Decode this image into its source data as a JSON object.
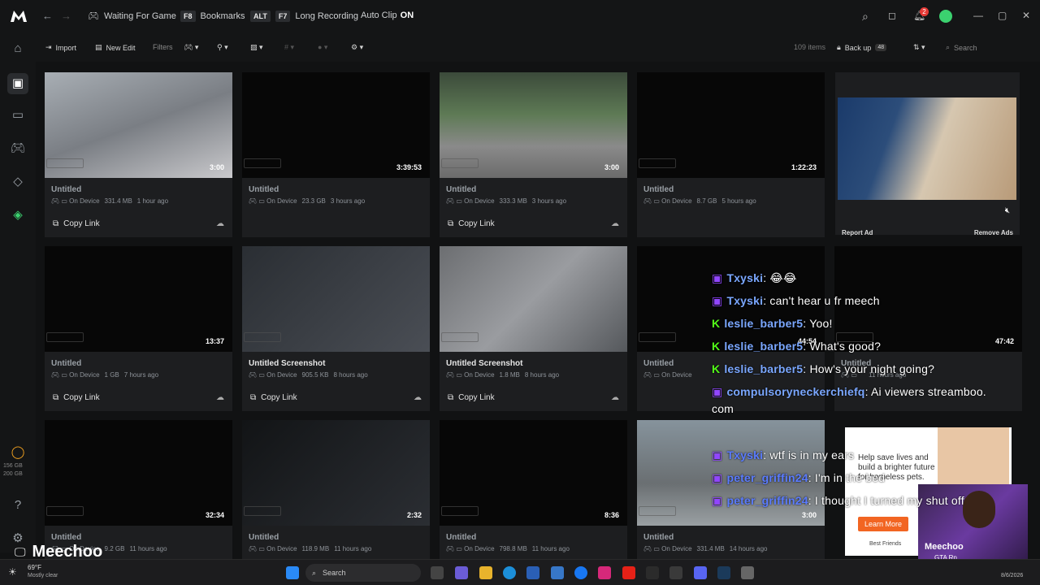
{
  "titlebar": {
    "status": "Waiting For Game",
    "bookmarks_key": "F8",
    "bookmarks_label": "Bookmarks",
    "alt_key": "ALT",
    "long_key": "F7",
    "long_label": "Long Recording",
    "autoclip_label": "Auto Clip",
    "autoclip_state": "ON",
    "notif_count": "2"
  },
  "toolbar": {
    "import": "Import",
    "new_edit": "New Edit",
    "filters": "Filters",
    "count": "109 items",
    "backup": "Back up",
    "backup_count": "48",
    "search_placeholder": "Search"
  },
  "storage": {
    "used": "156 GB",
    "total": "200 GB"
  },
  "cards": [
    {
      "title": "Untitled",
      "where": "On Device",
      "size": "331.4 MB",
      "age": "1 hour ago",
      "dur": "3:00",
      "copy": "Copy Link"
    },
    {
      "title": "Untitled",
      "where": "On Device",
      "size": "23.3 GB",
      "age": "3 hours ago",
      "dur": "3:39:53",
      "copy": ""
    },
    {
      "title": "Untitled",
      "where": "On Device",
      "size": "333.3 MB",
      "age": "3 hours ago",
      "dur": "3:00",
      "copy": "Copy Link"
    },
    {
      "title": "Untitled",
      "where": "On Device",
      "size": "8.7 GB",
      "age": "5 hours ago",
      "dur": "1:22:23",
      "copy": ""
    },
    {
      "title": "Untitled",
      "where": "On Device",
      "size": "1 GB",
      "age": "7 hours ago",
      "dur": "13:37",
      "copy": "Copy Link"
    },
    {
      "title": "Untitled Screenshot",
      "where": "On Device",
      "size": "905.5 KB",
      "age": "8 hours ago",
      "dur": "",
      "copy": "Copy Link"
    },
    {
      "title": "Untitled Screenshot",
      "where": "On Device",
      "size": "1.8 MB",
      "age": "8 hours ago",
      "dur": "",
      "copy": "Copy Link"
    },
    {
      "title": "Untitled",
      "where": "On Device",
      "size": "",
      "age": "",
      "dur": "44:54",
      "copy": ""
    },
    {
      "title": "Untitled",
      "where": "",
      "size": "",
      "age": "11 hours ago",
      "dur": "47:42",
      "copy": ""
    },
    {
      "title": "Untitled",
      "where": "On Device",
      "size": "9.2 GB",
      "age": "11 hours ago",
      "dur": "32:34",
      "copy": ""
    },
    {
      "title": "Untitled",
      "where": "On Device",
      "size": "118.9 MB",
      "age": "11 hours ago",
      "dur": "2:32",
      "copy": ""
    },
    {
      "title": "Untitled",
      "where": "On Device",
      "size": "798.8 MB",
      "age": "11 hours ago",
      "dur": "8:36",
      "copy": ""
    },
    {
      "title": "Untitled",
      "where": "On Device",
      "size": "331.4 MB",
      "age": "14 hours ago",
      "dur": "3:00",
      "copy": ""
    }
  ],
  "ad": {
    "report": "Report Ad",
    "remove": "Remove Ads",
    "ad2_text": "Help save lives and build a brighter future for homeless pets.",
    "ad2_button": "Learn More",
    "ad2_brand": "Best Friends"
  },
  "chat": [
    {
      "user": "Txyski",
      "msg": "😂😂",
      "color": "#7aa7ff",
      "badge": "twitch"
    },
    {
      "user": "Txyski",
      "msg": "can't hear u fr meech",
      "color": "#7aa7ff",
      "badge": "twitch"
    },
    {
      "user": "leslie_barber5",
      "msg": "Yoo!",
      "color": "#7aa7ff",
      "badge": "kick"
    },
    {
      "user": "leslie_barber5",
      "msg": "What's good?",
      "color": "#7aa7ff",
      "badge": "kick"
    },
    {
      "user": "leslie_barber5",
      "msg": "How's your night going?",
      "color": "#7aa7ff",
      "badge": "kick"
    },
    {
      "user": "compulsoryneckerchiefq",
      "msg": "Ai viewers streamboo.",
      "color": "#7aa7ff",
      "badge": "twitch"
    },
    {
      "user": "",
      "msg": "com",
      "color": "#fff",
      "badge": ""
    },
    {
      "user": "Txyski",
      "msg": "wtf is in my ears",
      "color": "#5b7cff",
      "badge": "twitch"
    },
    {
      "user": "peter_griffin24",
      "msg": "I'm in the bed",
      "color": "#5b7cff",
      "badge": "twitch"
    },
    {
      "user": "peter_griffin24",
      "msg": "I thought I turned my shut off",
      "color": "#5b7cff",
      "badge": "twitch"
    }
  ],
  "streamer": {
    "name": "Meechoo",
    "sub": "GTA Rp",
    "overlay_name": "Meechoo"
  },
  "weather": {
    "temp": "69°F",
    "cond": "Mostly clear"
  },
  "taskbar": {
    "search": "Search",
    "date": "8/6/2026"
  },
  "colors": {
    "accent_green": "#3bd16f",
    "notif_red": "#e53935",
    "kick_green": "#53fc18",
    "twitch_purple": "#9146ff"
  }
}
